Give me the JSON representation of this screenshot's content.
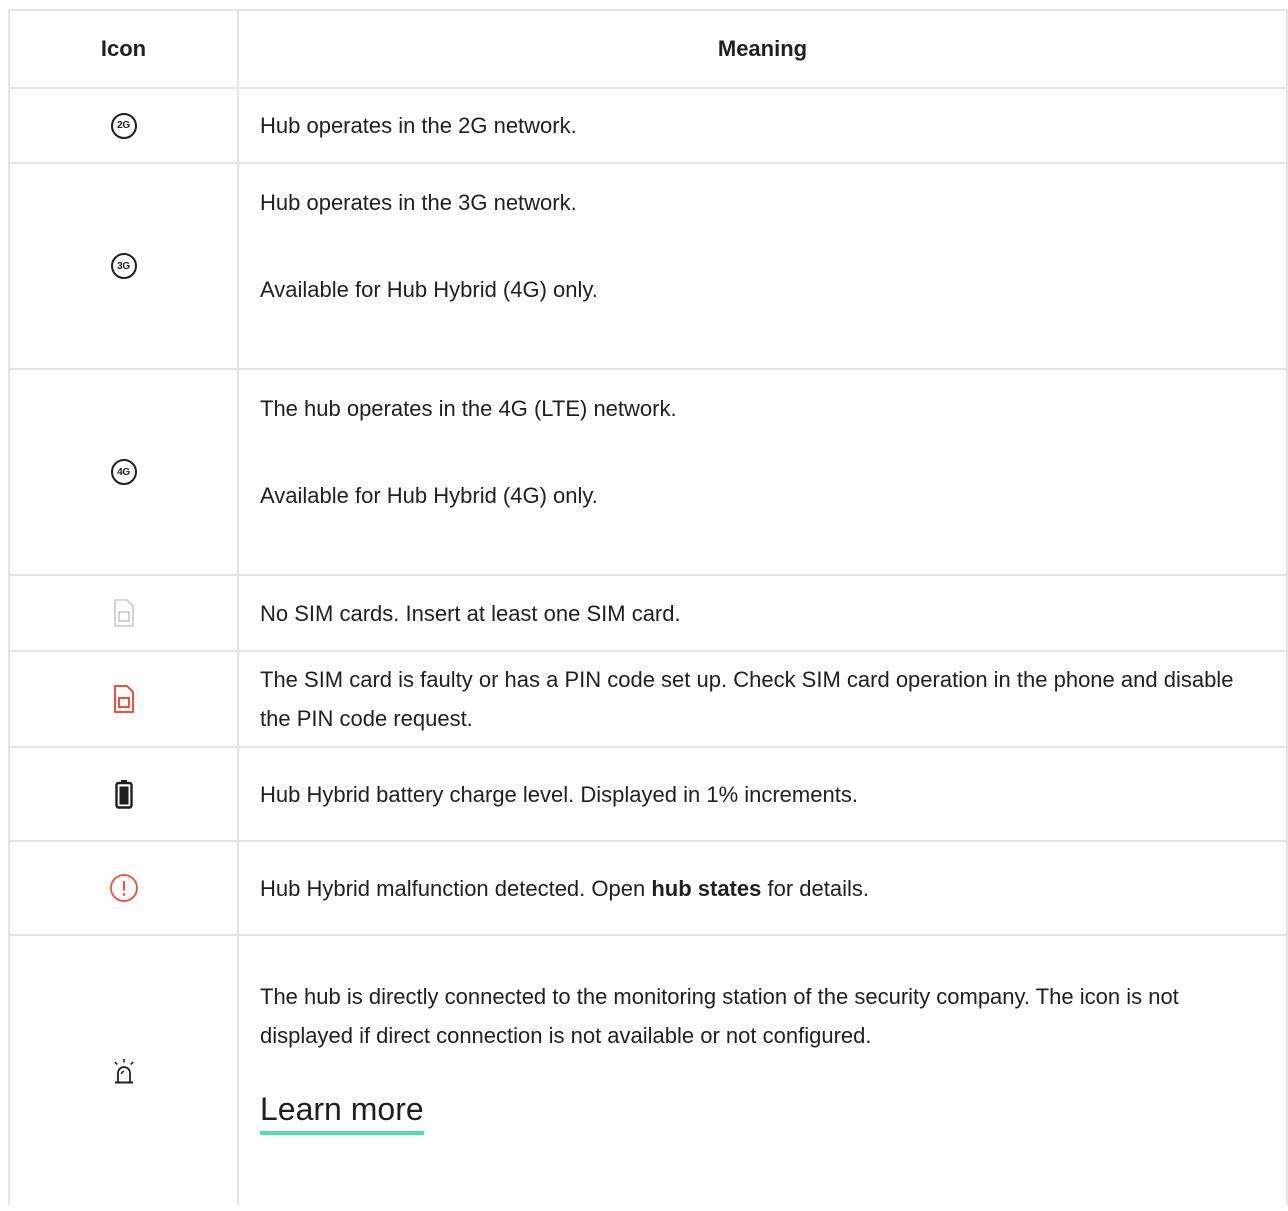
{
  "header": {
    "icon_col": "Icon",
    "meaning_col": "Meaning"
  },
  "rows": [
    {
      "icon": "2g-network-icon",
      "icon_text": "2G",
      "lines": [
        "Hub operates in the 2G network."
      ]
    },
    {
      "icon": "3g-network-icon",
      "icon_text": "3G",
      "lines": [
        "Hub operates in the 3G network.",
        "Available for Hub Hybrid (4G) only."
      ]
    },
    {
      "icon": "4g-network-icon",
      "icon_text": "4G",
      "lines": [
        "The hub operates in the 4G (LTE) network.",
        "Available for Hub Hybrid (4G) only."
      ]
    },
    {
      "icon": "no-sim-icon",
      "icon_color": "#c8c8c8",
      "lines": [
        "No SIM cards. Insert at least one SIM card."
      ]
    },
    {
      "icon": "faulty-sim-icon",
      "icon_color": "#f0503c",
      "lines": [
        "The SIM card is faulty or has a PIN code set up. Check SIM card operation in the phone and disable the PIN code request."
      ]
    },
    {
      "icon": "battery-icon",
      "lines": [
        "Hub Hybrid battery charge level. Displayed in 1% increments."
      ]
    },
    {
      "icon": "malfunction-icon",
      "icon_color": "#f0503c",
      "text_before": "Hub Hybrid malfunction detected. Open ",
      "text_bold": "hub states",
      "text_after": " for details."
    },
    {
      "icon": "monitoring-station-icon",
      "lines": [
        "The hub is directly connected to the monitoring station of the security company. The icon is not displayed if direct connection is not available or not configured."
      ],
      "link": "Learn more",
      "link_color": "#4fdfa5"
    }
  ]
}
